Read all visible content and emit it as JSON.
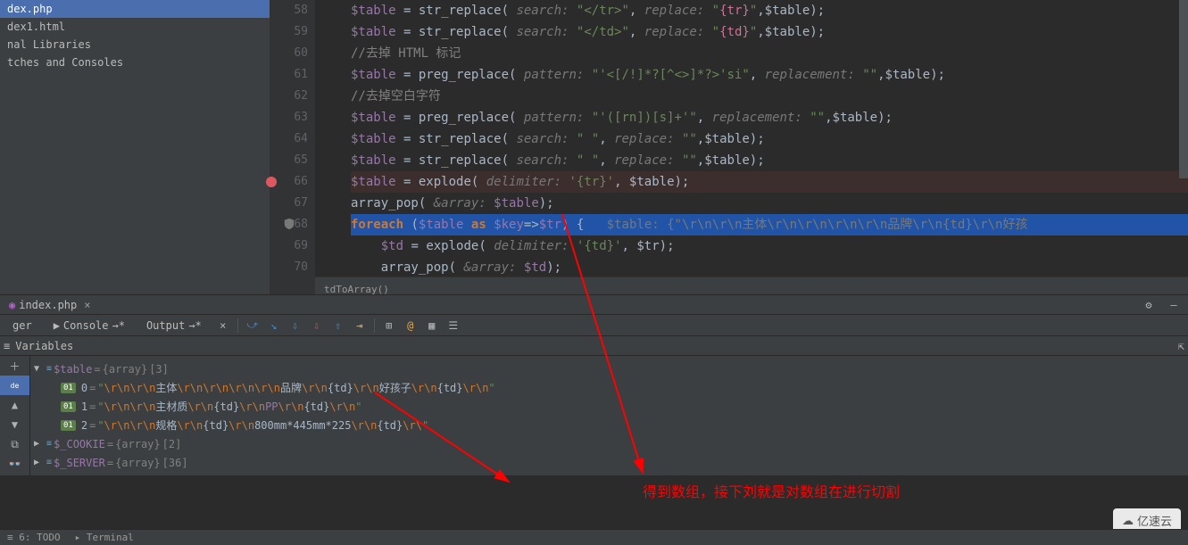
{
  "sidebar": {
    "items": [
      {
        "label": "dex.php"
      },
      {
        "label": "dex1.html"
      },
      {
        "label": "nal Libraries"
      },
      {
        "label": "tches and Consoles"
      }
    ]
  },
  "gutter_lines": [
    "58",
    "59",
    "60",
    "61",
    "62",
    "63",
    "64",
    "65",
    "66",
    "67",
    "68",
    "69",
    "70"
  ],
  "code": {
    "l58": {
      "pre": "$table",
      "fn": "str_replace",
      "h1": "search:",
      "s1": "\"</tr>\"",
      "h2": "replace:",
      "s2": "\"{tr}\"",
      "post": ",$table);"
    },
    "l59": {
      "pre": "$table",
      "fn": "str_replace",
      "h1": "search:",
      "s1": "\"</td>\"",
      "h2": "replace:",
      "s2": "\"{td}\"",
      "post": ",$table);"
    },
    "l60": "//去掉 HTML 标记",
    "l61": {
      "pre": "$table",
      "fn": "preg_replace",
      "h1": "pattern:",
      "s1": "\"'<[/!]*?[^<>]*?>'si\"",
      "h2": "replacement:",
      "s2": "\"\"",
      "post": ",$table);"
    },
    "l62": "//去掉空白字符",
    "l63": {
      "pre": "$table",
      "fn": "preg_replace",
      "h1": "pattern:",
      "s1": "\"'([rn])[s]+'\"",
      "h2": "replacement:",
      "s2": "\"\"",
      "post": ",$table);"
    },
    "l64": {
      "pre": "$table",
      "fn": "str_replace",
      "h1": "search:",
      "s1": "\" \"",
      "h2": "replace:",
      "s2": "\"\"",
      "post": ",$table);"
    },
    "l65": {
      "pre": "$table",
      "fn": "str_replace",
      "h1": "search:",
      "s1": "\" \"",
      "h2": "replace:",
      "s2": "\"\"",
      "post": ",$table);"
    },
    "l66": {
      "pre": "$table",
      "fn": "explode",
      "h1": "delimiter:",
      "s1": "'{tr}'",
      "post": ", $table);"
    },
    "l67": {
      "fn": "array_pop",
      "h1": "&array:",
      "arg": "$table"
    },
    "l68": {
      "kw": "foreach",
      "open": "(",
      "v1": "$table",
      "as": "as",
      "v2": "$key",
      "arrow": "=>",
      "v3": "$tr",
      "close": ") {",
      "hint": "$table: {\"\\r\\n\\r\\n主体\\r\\n\\r\\n\\r\\n\\r\\n品牌\\r\\n{td}\\r\\n好孩"
    },
    "l69": {
      "pre": "$td",
      "fn": "explode",
      "h1": "delimiter:",
      "s1": "'{td}'",
      "post": ", $tr);"
    },
    "l70": {
      "fn": "array_pop",
      "h1": "&array:",
      "arg": "$td"
    }
  },
  "breadcrumb": "tdToArray()",
  "debug_tab": {
    "file": "index.php"
  },
  "toolbar_tabs": [
    {
      "label": "ger"
    },
    {
      "label": "Console",
      "arrow": "→*"
    },
    {
      "label": "Output",
      "arrow": "→*"
    }
  ],
  "variables_title": "Variables",
  "tree": {
    "root": {
      "name": "$table",
      "type": "{array}",
      "count": "[3]"
    },
    "items": [
      {
        "key": "0",
        "parts": [
          "\"",
          "\\r\\n\\r\\n",
          "主体",
          "\\r\\n\\r\\n\\r\\n\\r\\n",
          "品牌",
          "\\r\\n",
          "{td}",
          "\\r\\n",
          "好孩子",
          "\\r\\n",
          "{td}",
          "\\r\\n",
          "\""
        ]
      },
      {
        "key": "1",
        "parts": [
          "\"",
          "\\r\\n\\r\\n",
          "主材质",
          "\\r\\n",
          "{td}",
          "\\r\\n",
          "PP",
          "\\r\\n",
          "{td}",
          "\\r\\n",
          "\""
        ]
      },
      {
        "key": "2",
        "parts": [
          "\"",
          "\\r\\n\\r\\n",
          "规格",
          "\\r\\n",
          "{td}",
          "\\r\\n",
          "800mm*445mm*225",
          "\\r\\n",
          "{td}",
          "\\r\\",
          "\""
        ]
      }
    ],
    "cookie": {
      "name": "$_COOKIE",
      "type": "{array}",
      "count": "[2]"
    },
    "server": {
      "name": "$_SERVER",
      "type": "{array}",
      "count": "[36]"
    }
  },
  "annotation": "得到数组，接下刘就是对数组在进行切割",
  "footer": {
    "todo": "6: TODO",
    "terminal": "Terminal"
  },
  "watermark": "亿速云"
}
